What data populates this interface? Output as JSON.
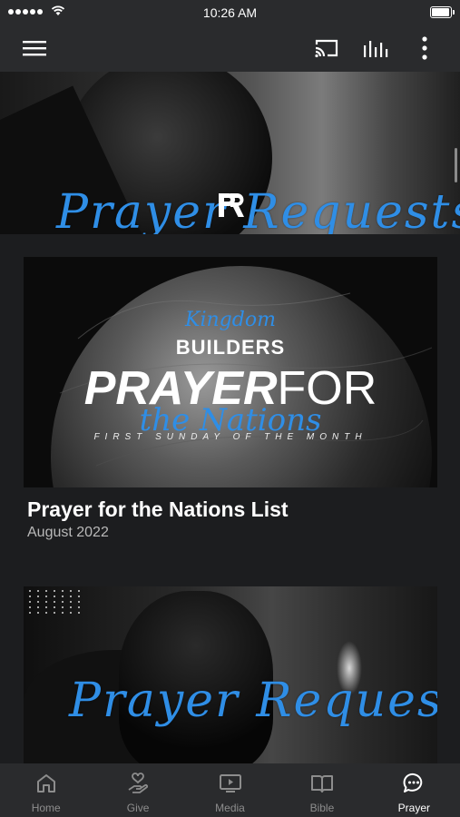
{
  "status_bar": {
    "time": "10:26 AM",
    "signal_bars": 5,
    "battery_level": 0.95
  },
  "app_bar": {
    "icons": [
      "menu-icon",
      "cast-icon",
      "equalizer-icon",
      "more-vertical-icon"
    ]
  },
  "banner": {
    "title": "Prayer Requests",
    "logo_text": "PR"
  },
  "cards": [
    {
      "image": {
        "kingdom": "Kingdom",
        "builders": "BUILDERS",
        "prayer": "PRAYER",
        "for": "FOR",
        "nations": "the Nations",
        "subtitle": "FIRST SUNDAY OF THE MONTH"
      },
      "title": "Prayer for the Nations List",
      "date": "August 2022"
    },
    {
      "image": {
        "title": "Prayer Requests"
      }
    }
  ],
  "bottom_nav": {
    "active": "Prayer",
    "tabs": [
      {
        "label": "Home",
        "icon": "home-icon"
      },
      {
        "label": "Give",
        "icon": "give-hand-heart-icon"
      },
      {
        "label": "Media",
        "icon": "media-play-icon"
      },
      {
        "label": "Bible",
        "icon": "bible-book-icon"
      },
      {
        "label": "Prayer",
        "icon": "prayer-chat-icon"
      }
    ]
  },
  "colors": {
    "accent_blue": "#2f8ee6",
    "bar_bg": "#2a2b2d",
    "page_bg": "#1c1d1f"
  }
}
